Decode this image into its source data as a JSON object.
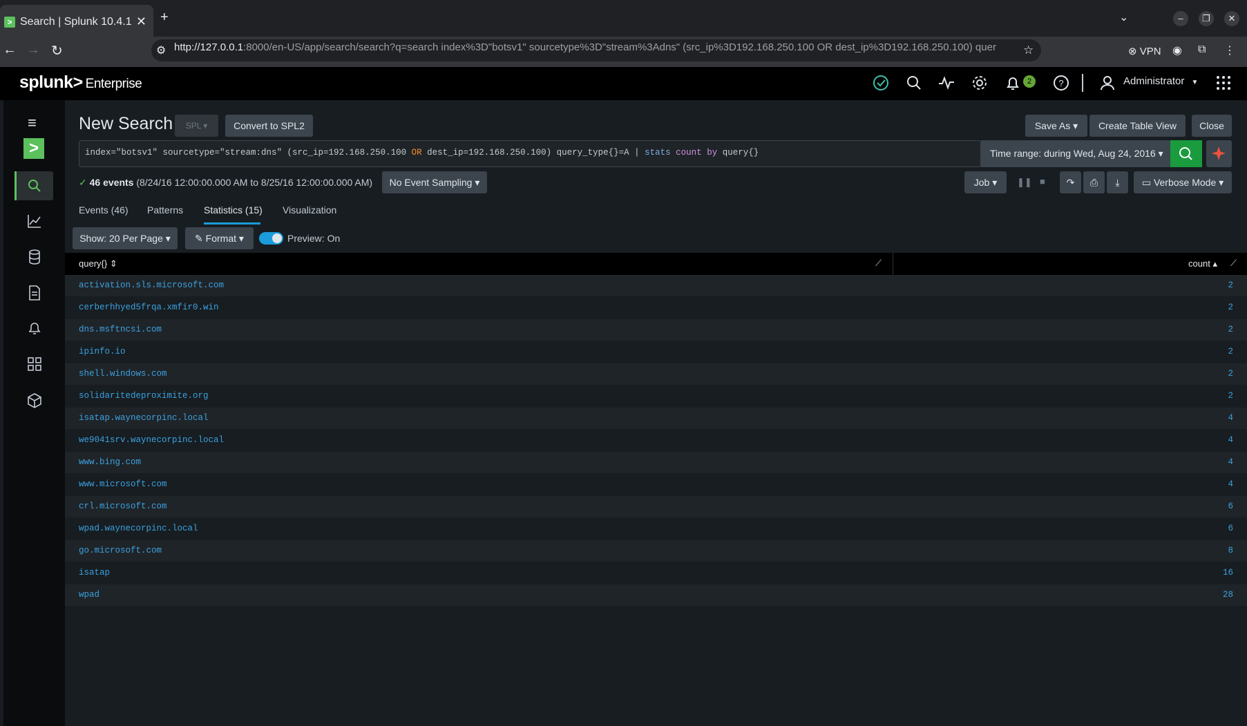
{
  "browser": {
    "tab_title": "Search | Splunk 10.4.1",
    "favicon": ">",
    "url_host": "http://127.0.0.1",
    "url_rest": ":8000/en-US/app/search/search?q=search index%3D\"botsv1\" sourcetype%3D\"stream%3Adns\" (src_ip%3D192.168.250.100 OR dest_ip%3D192.168.250.100) quer",
    "vpn_label": "VPN"
  },
  "header": {
    "logo_main": "splunk>",
    "logo_sub": "Enterprise",
    "notification_count": "2",
    "user": "Administrator"
  },
  "search": {
    "title": "New Search",
    "spl_label": "SPL",
    "convert_label": "Convert to SPL2",
    "save_as": "Save As",
    "create_table": "Create Table View",
    "close": "Close",
    "query_part1": "index=\"botsv1\" sourcetype=\"stream:dns\" (src_ip=192.168.250.100 ",
    "query_or": "OR",
    "query_part2": " dest_ip=192.168.250.100) query_type{}=A  | ",
    "query_cmd": "stats",
    "query_fn": " count",
    "query_by": " by",
    "query_field": " query{}",
    "time_range": "Time range: during Wed, Aug 24, 2016"
  },
  "status": {
    "count_text": "46 events",
    "range_text": "(8/24/16 12:00:00.000 AM to 8/25/16 12:00:00.000 AM)",
    "sampling": "No Event Sampling",
    "job": "Job",
    "mode": "Verbose Mode"
  },
  "tabs": [
    {
      "label": "Events (46)"
    },
    {
      "label": "Patterns"
    },
    {
      "label": "Statistics (15)"
    },
    {
      "label": "Visualization"
    }
  ],
  "toolbar": {
    "per_page": "Show: 20 Per Page",
    "format": "Format",
    "preview": "Preview: On"
  },
  "table": {
    "col_query": "query{}",
    "col_count": "count",
    "rows": [
      {
        "query": "activation.sls.microsoft.com",
        "count": "2"
      },
      {
        "query": "cerberhhyed5frqa.xmfir0.win",
        "count": "2"
      },
      {
        "query": "dns.msftncsi.com",
        "count": "2"
      },
      {
        "query": "ipinfo.io",
        "count": "2"
      },
      {
        "query": "shell.windows.com",
        "count": "2"
      },
      {
        "query": "solidaritedeproximite.org",
        "count": "2"
      },
      {
        "query": "isatap.waynecorpinc.local",
        "count": "4"
      },
      {
        "query": "we9041srv.waynecorpinc.local",
        "count": "4"
      },
      {
        "query": "www.bing.com",
        "count": "4"
      },
      {
        "query": "www.microsoft.com",
        "count": "4"
      },
      {
        "query": "crl.microsoft.com",
        "count": "6"
      },
      {
        "query": "wpad.waynecorpinc.local",
        "count": "6"
      },
      {
        "query": "go.microsoft.com",
        "count": "8"
      },
      {
        "query": "isatap",
        "count": "16"
      },
      {
        "query": "wpad",
        "count": "28"
      }
    ]
  },
  "colors": {
    "accent_green": "#5cc05c",
    "link_blue": "#3da1e0",
    "tab_active": "#1a9cdb"
  }
}
